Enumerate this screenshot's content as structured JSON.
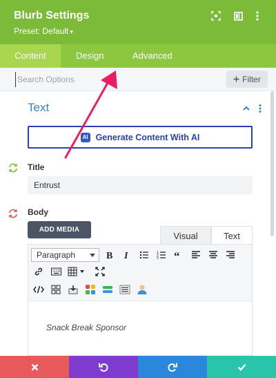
{
  "header": {
    "title": "Blurb Settings",
    "preset": "Preset: Default",
    "icons": [
      "focus-icon",
      "sidebar-icon",
      "kebab-icon"
    ]
  },
  "tabs": [
    {
      "label": "Content",
      "active": true
    },
    {
      "label": "Design",
      "active": false
    },
    {
      "label": "Advanced",
      "active": false
    }
  ],
  "search": {
    "placeholder": "Search Options",
    "value": "",
    "filter_label": "Filter"
  },
  "section": {
    "title": "Text",
    "generate_label": "Generate Content With AI",
    "ai_badge": "AI"
  },
  "fields": {
    "title_label": "Title",
    "title_value": "Entrust",
    "body_label": "Body",
    "add_media_label": "ADD MEDIA",
    "visual_tab": "Visual",
    "text_tab": "Text",
    "format_value": "Paragraph",
    "body_content": "Snack Break Sponsor"
  },
  "footer": {
    "buttons": [
      "close",
      "undo",
      "redo",
      "save"
    ],
    "colors": [
      "#e7595a",
      "#7e3bd0",
      "#2b87da",
      "#29c4a9"
    ]
  },
  "colors": {
    "header_bg": "#7cbb3a",
    "tabs_bg": "#8dc63f",
    "active_tab_bg": "#a8d64e",
    "section_title": "#2e84c6",
    "ai_border": "#2c3fb5",
    "arrow": "#ea1e63"
  }
}
